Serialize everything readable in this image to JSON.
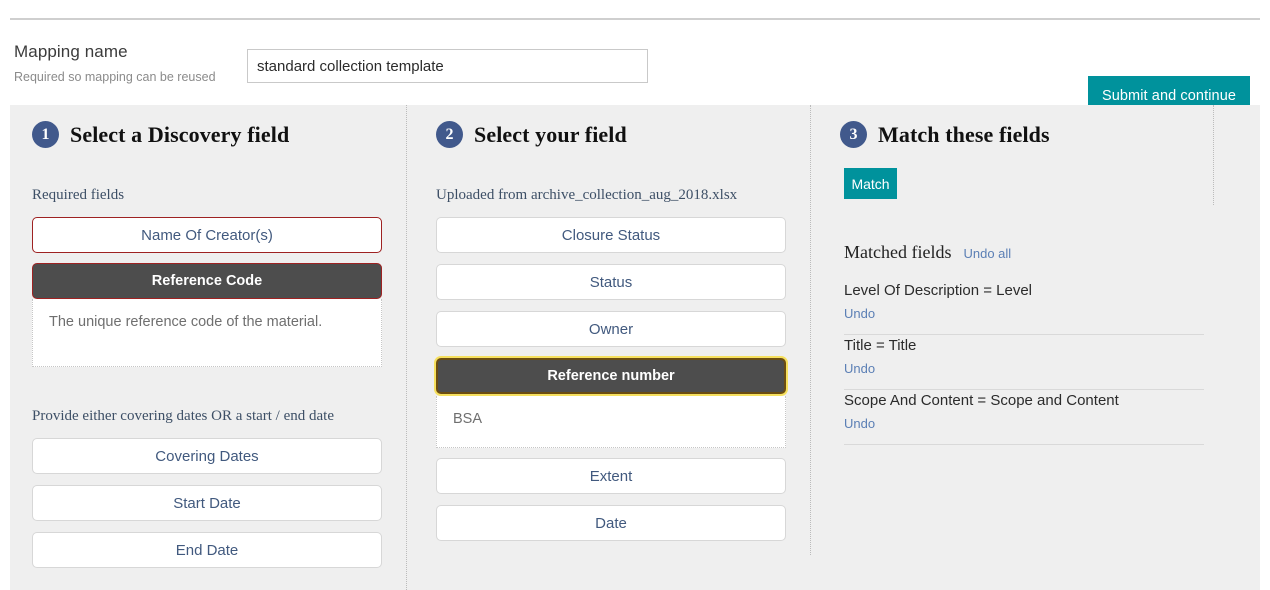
{
  "header": {
    "mapping_label": "Mapping name",
    "mapping_sublabel": "Required so mapping can be reused",
    "mapping_value": "standard collection template",
    "mapping_placeholder": "",
    "submit_label": "Submit and continue"
  },
  "colors": {
    "accent_teal": "#00929c",
    "step_circle": "#41598c",
    "required_border": "#9e2222",
    "selected_bg": "#4d4d4d",
    "highlight_gold": "#f6e05e",
    "panel_bg": "#efefef",
    "link_blue": "#5b7fb5"
  },
  "column1": {
    "step_number": "1",
    "step_title": "Select a Discovery field",
    "required_label": "Required fields",
    "dates_label": "Provide either covering dates OR a start / end date",
    "required_fields": [
      {
        "label": "Name Of Creator(s)",
        "state": "required"
      },
      {
        "label": "Reference Code",
        "state": "selected",
        "description": "The unique reference code of the material."
      }
    ],
    "date_fields": [
      {
        "label": "Covering Dates",
        "state": "normal"
      },
      {
        "label": "Start Date",
        "state": "normal"
      },
      {
        "label": "End Date",
        "state": "normal"
      }
    ]
  },
  "column2": {
    "step_number": "2",
    "step_title": "Select your field",
    "uploaded_label": "Uploaded from archive_collection_aug_2018.xlsx",
    "fields": [
      {
        "label": "Closure Status",
        "state": "normal"
      },
      {
        "label": "Status",
        "state": "normal"
      },
      {
        "label": "Owner",
        "state": "normal"
      },
      {
        "label": "Reference number",
        "state": "selected-gold",
        "description": "BSA"
      },
      {
        "label": "Extent",
        "state": "normal"
      },
      {
        "label": "Date",
        "state": "normal"
      }
    ]
  },
  "column3": {
    "step_number": "3",
    "step_title": "Match these fields",
    "match_button": "Match",
    "matched_title": "Matched fields",
    "undo_all_label": "Undo all",
    "undo_label": "Undo",
    "matched": [
      {
        "pair": "Level Of Description = Level",
        "undo": "Undo"
      },
      {
        "pair": "Title = Title",
        "undo": "Undo"
      },
      {
        "pair": "Scope And Content = Scope and Content",
        "undo": "Undo"
      }
    ]
  }
}
